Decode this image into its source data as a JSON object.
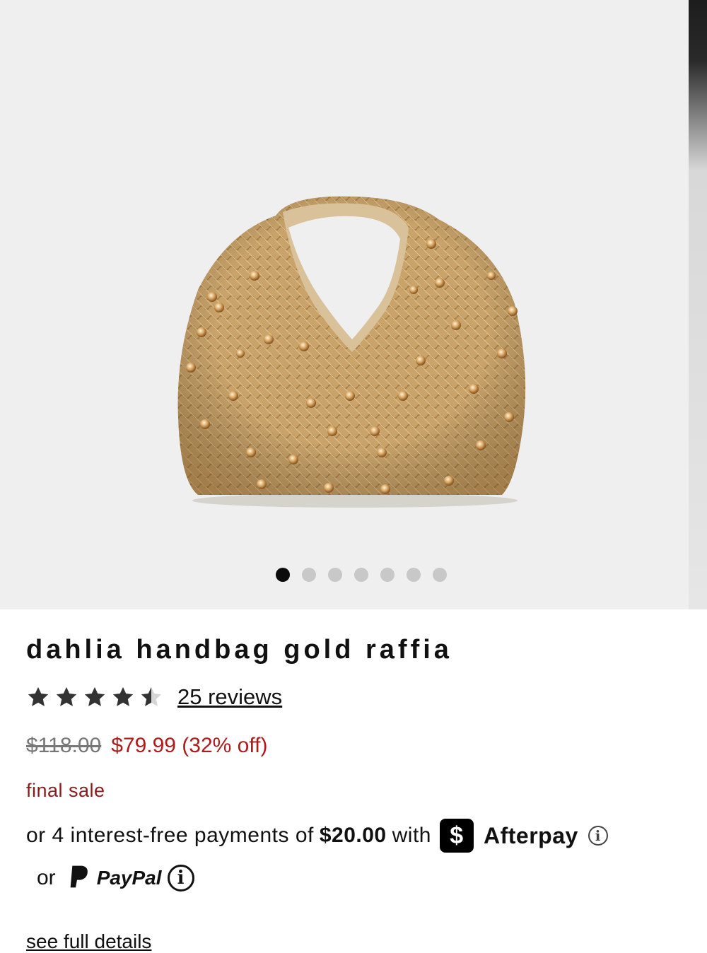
{
  "gallery": {
    "image_alt": "dahlia handbag gold raffia",
    "dots_total": 7,
    "active_index": 0
  },
  "product": {
    "title": "dahlia handbag gold raffia",
    "rating_value": 4.5,
    "rating_max": 5,
    "reviews_label": "25 reviews",
    "original_price": "$118.00",
    "sale_price": "$79.99 (32% off)",
    "final_sale": "final sale"
  },
  "payments": {
    "afterpay_prefix": "or 4 interest-free payments of",
    "afterpay_amount": "$20.00",
    "afterpay_with": "with",
    "cash_icon": "$",
    "afterpay_label": "Afterpay",
    "info_glyph": "i",
    "or_label": "or",
    "paypal_label": "PayPal"
  },
  "links": {
    "see_full_details": "see full details"
  },
  "colors": {
    "sale_red": "#b11a1a",
    "final_sale_red": "#8a1c1c",
    "gallery_bg": "#efefef",
    "bag_gold": "#c9a36a"
  }
}
